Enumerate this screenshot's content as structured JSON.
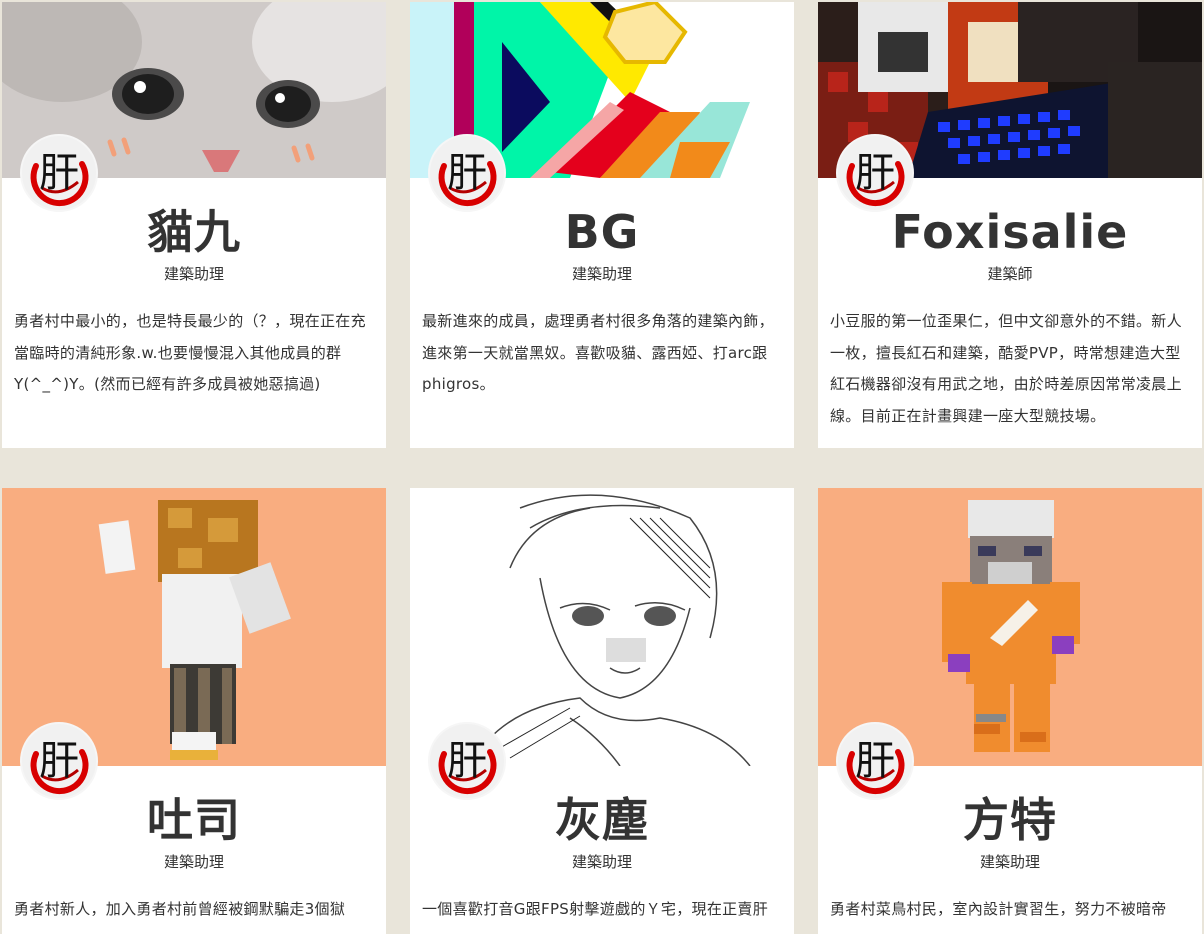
{
  "avatar_glyph": "肝",
  "colors": {
    "background": "#e9e5da",
    "card": "#ffffff",
    "peach": "#f9ad80",
    "ring": "#d80000"
  },
  "members": [
    {
      "name": "貓九",
      "role": "建築助理",
      "desc": "勇者村中最小的，也是特長最少的（？，現在正在充當臨時的清純形象.w.也要慢慢混入其他成員的群Y(^_^)Y。(然而已經有許多成員被她惡搞過)",
      "cover": "cat-photo"
    },
    {
      "name": "BG",
      "role": "建築助理",
      "desc": "最新進來的成員，處理勇者村很多角落的建築內飾，進來第一天就當黑奴。喜歡吸貓、露西婭、打arc跟phigros。",
      "cover": "abstract-art"
    },
    {
      "name": "Foxisalie",
      "role": "建築師",
      "desc": "小豆服的第一位歪果仁，但中文卻意外的不錯。新人一枚，擅長紅石和建築，酷愛PVP，時常想建造大型紅石機器卻沒有用武之地，由於時差原因常常凌晨上線。目前正在計畫興建一座大型競技場。",
      "cover": "minecraft-redstone"
    },
    {
      "name": "吐司",
      "role": "建築助理",
      "desc": "勇者村新人，加入勇者村前曾經被鋼默騙走3個獄",
      "cover": "minecraft-skin-toast"
    },
    {
      "name": "灰塵",
      "role": "建築助理",
      "desc": "一個喜歡打音G跟FPS射擊遊戲的Ｙ宅，現在正賣肝",
      "cover": "pencil-sketch"
    },
    {
      "name": "方特",
      "role": "建築助理",
      "desc": "勇者村菜鳥村民，室內設計實習生，努力不被暗帝",
      "cover": "minecraft-skin-chef"
    }
  ]
}
